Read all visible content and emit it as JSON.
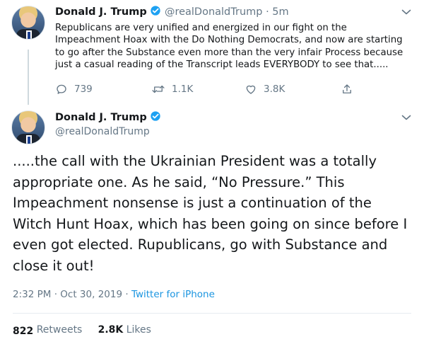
{
  "tweet1": {
    "name": "Donald J. Trump",
    "handle": "@realDonaldTrump",
    "separator": "·",
    "time": "5m",
    "text": "Republicans are very unified and energized in our fight on the Impeachment Hoax with the Do Nothing Democrats, and now  are starting to go after the Substance even more than the very infair Process because just a casual reading of the Transcript leads EVERYBODY to see that.....",
    "replies": "739",
    "retweets": "1.1K",
    "likes": "3.8K"
  },
  "tweet2": {
    "name": "Donald J. Trump",
    "handle": "@realDonaldTrump",
    "text": ".....the call with the Ukrainian President was a totally appropriate one. As he said, “No Pressure.” This Impeachment nonsense is just a continuation of the Witch Hunt Hoax, which has been going on since before I even got elected. Rupublicans, go with Substance and close it out!",
    "time": "2:32 PM",
    "sep1": "·",
    "date": "Oct 30, 2019",
    "sep2": "·",
    "source": "Twitter for iPhone",
    "retweet_count": "822",
    "retweet_label": "Retweets",
    "like_count": "2.8K",
    "like_label": "Likes"
  },
  "icons": {
    "verified": "verified-badge-icon",
    "reply": "reply-icon",
    "retweet": "retweet-icon",
    "like": "heart-icon",
    "share": "share-icon",
    "menu": "chevron-down-icon"
  },
  "colors": {
    "verified": "#1da1f2",
    "link": "#1b95e0",
    "secondary_text": "#657786",
    "divider": "#e6ecf0"
  }
}
